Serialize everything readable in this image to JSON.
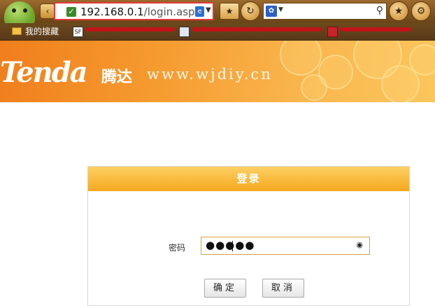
{
  "browser": {
    "address_url_host": "192.168.0.1",
    "address_url_path": "/login.asp",
    "bookmarks": [
      {
        "label": "我的搜藏",
        "icon": "folder-icon"
      },
      {
        "label": "",
        "icon": "sf-favicon",
        "glyph": "SF"
      }
    ],
    "icons": {
      "back": "back-arrow-icon",
      "secure": "secure-check-icon",
      "ie": "ie-compat-icon",
      "star": "favorite-star-icon",
      "refresh": "refresh-icon",
      "search_engine": "paw-icon",
      "search": "search-icon"
    }
  },
  "header": {
    "logo": "Tenda",
    "logo_cn": "腾达",
    "watermark": "www.wjdiy.cn"
  },
  "login": {
    "title": "登录",
    "password_label": "密码",
    "password_mask": "●●●●●",
    "confirm_label": "确定",
    "cancel_label": "取消"
  },
  "colors": {
    "header_orange": "#f59a2e",
    "card_head": "#f6a81e",
    "url_highlight": "#e2383a"
  }
}
